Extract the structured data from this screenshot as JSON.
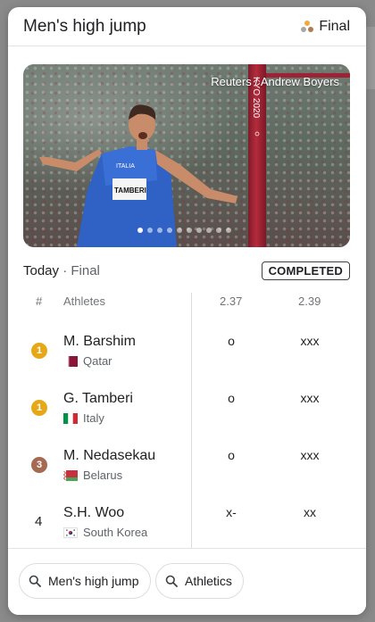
{
  "header": {
    "title": "Men's high jump",
    "status": "Final"
  },
  "photo": {
    "credit": "Reuters / Andrew Boyers",
    "carousel": {
      "total": 10,
      "active": 0
    }
  },
  "summary": {
    "day": "Today",
    "separator": "·",
    "phase": "Final",
    "badge": "COMPLETED"
  },
  "table": {
    "headers": {
      "rank": "#",
      "athletes": "Athletes",
      "height1": "2.37",
      "height2": "2.39"
    },
    "rows": [
      {
        "rank": "1",
        "medal": "gold",
        "name": "M. Barshim",
        "country": "Qatar",
        "h1": "o",
        "h2": "xxx"
      },
      {
        "rank": "1",
        "medal": "gold",
        "name": "G. Tamberi",
        "country": "Italy",
        "h1": "o",
        "h2": "xxx"
      },
      {
        "rank": "3",
        "medal": "bronze",
        "name": "M. Nedasekau",
        "country": "Belarus",
        "h1": "o",
        "h2": "xxx"
      },
      {
        "rank": "4",
        "medal": "",
        "name": "S.H. Woo",
        "country": "South Korea",
        "h1": "x-",
        "h2": "xx"
      }
    ]
  },
  "chips": [
    {
      "label": "Men's high jump",
      "icon": "search-icon"
    },
    {
      "label": "Athletics",
      "icon": "search-icon"
    }
  ],
  "colors": {
    "gold": "#e6a817",
    "bronze": "#a66a52",
    "text": "#202124",
    "muted": "#70757a"
  }
}
